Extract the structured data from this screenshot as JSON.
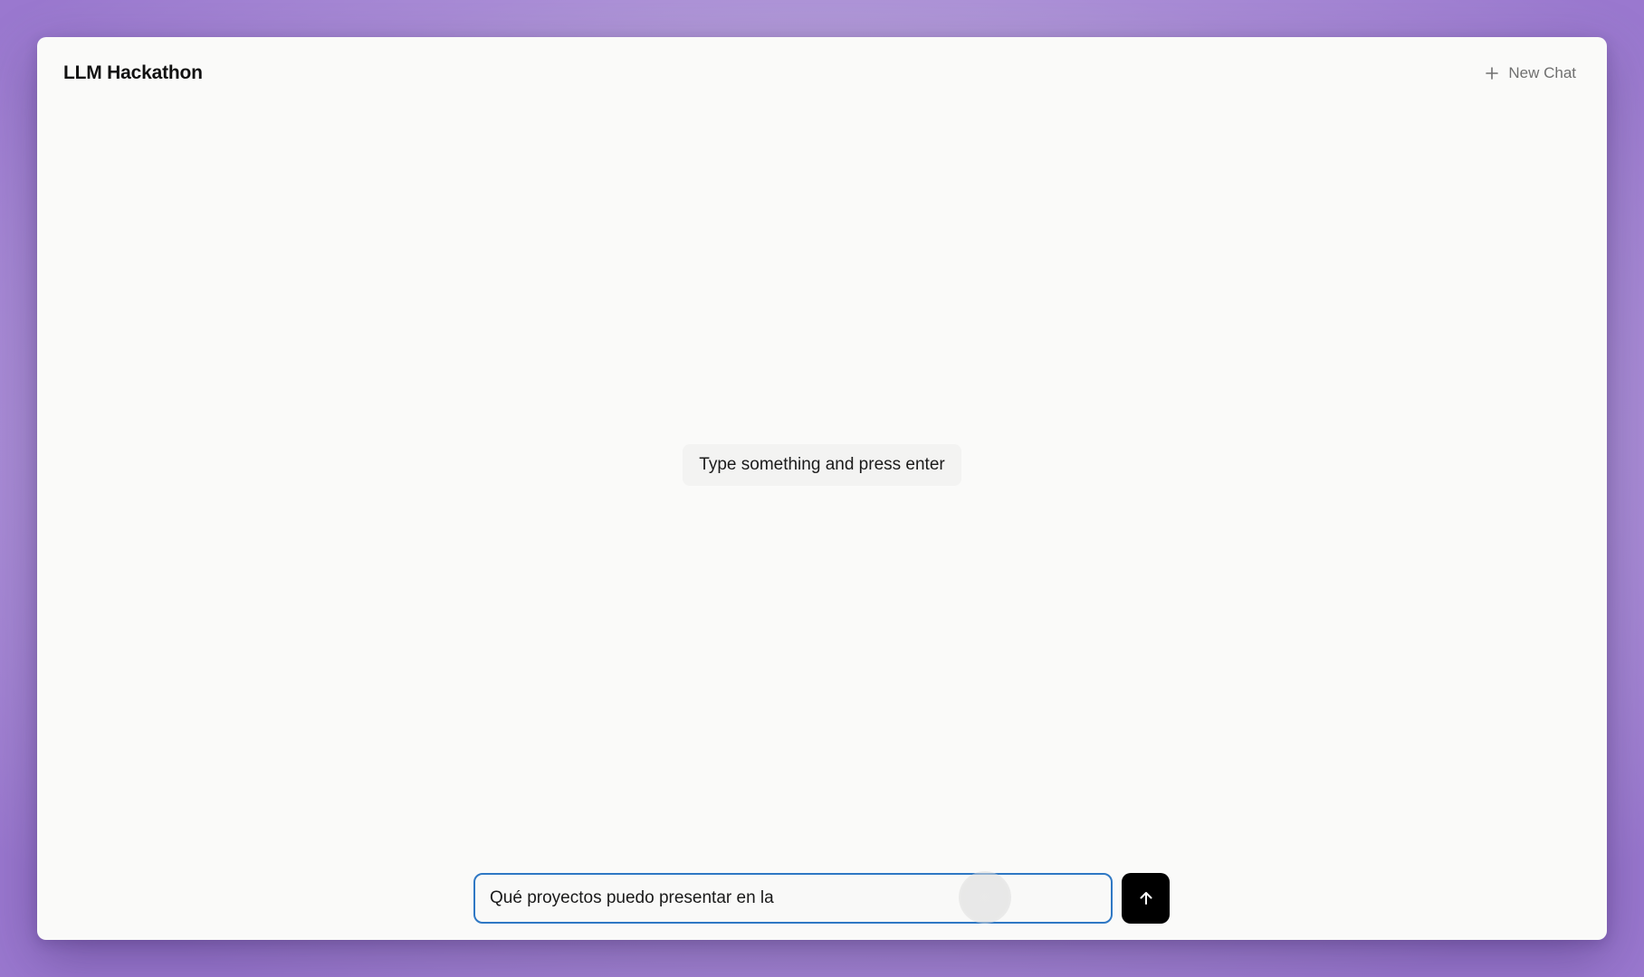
{
  "header": {
    "title": "LLM Hackathon",
    "new_chat_label": "New Chat",
    "new_chat_icon": "plus-icon"
  },
  "main": {
    "empty_message": "Type something and press enter"
  },
  "composer": {
    "input_value": "Qué proyectos puedo presentar en la ",
    "send_icon": "arrow-up-icon"
  },
  "colors": {
    "input_border": "#2f78c4",
    "send_button_bg": "#000000",
    "window_bg": "#fafaf9"
  }
}
